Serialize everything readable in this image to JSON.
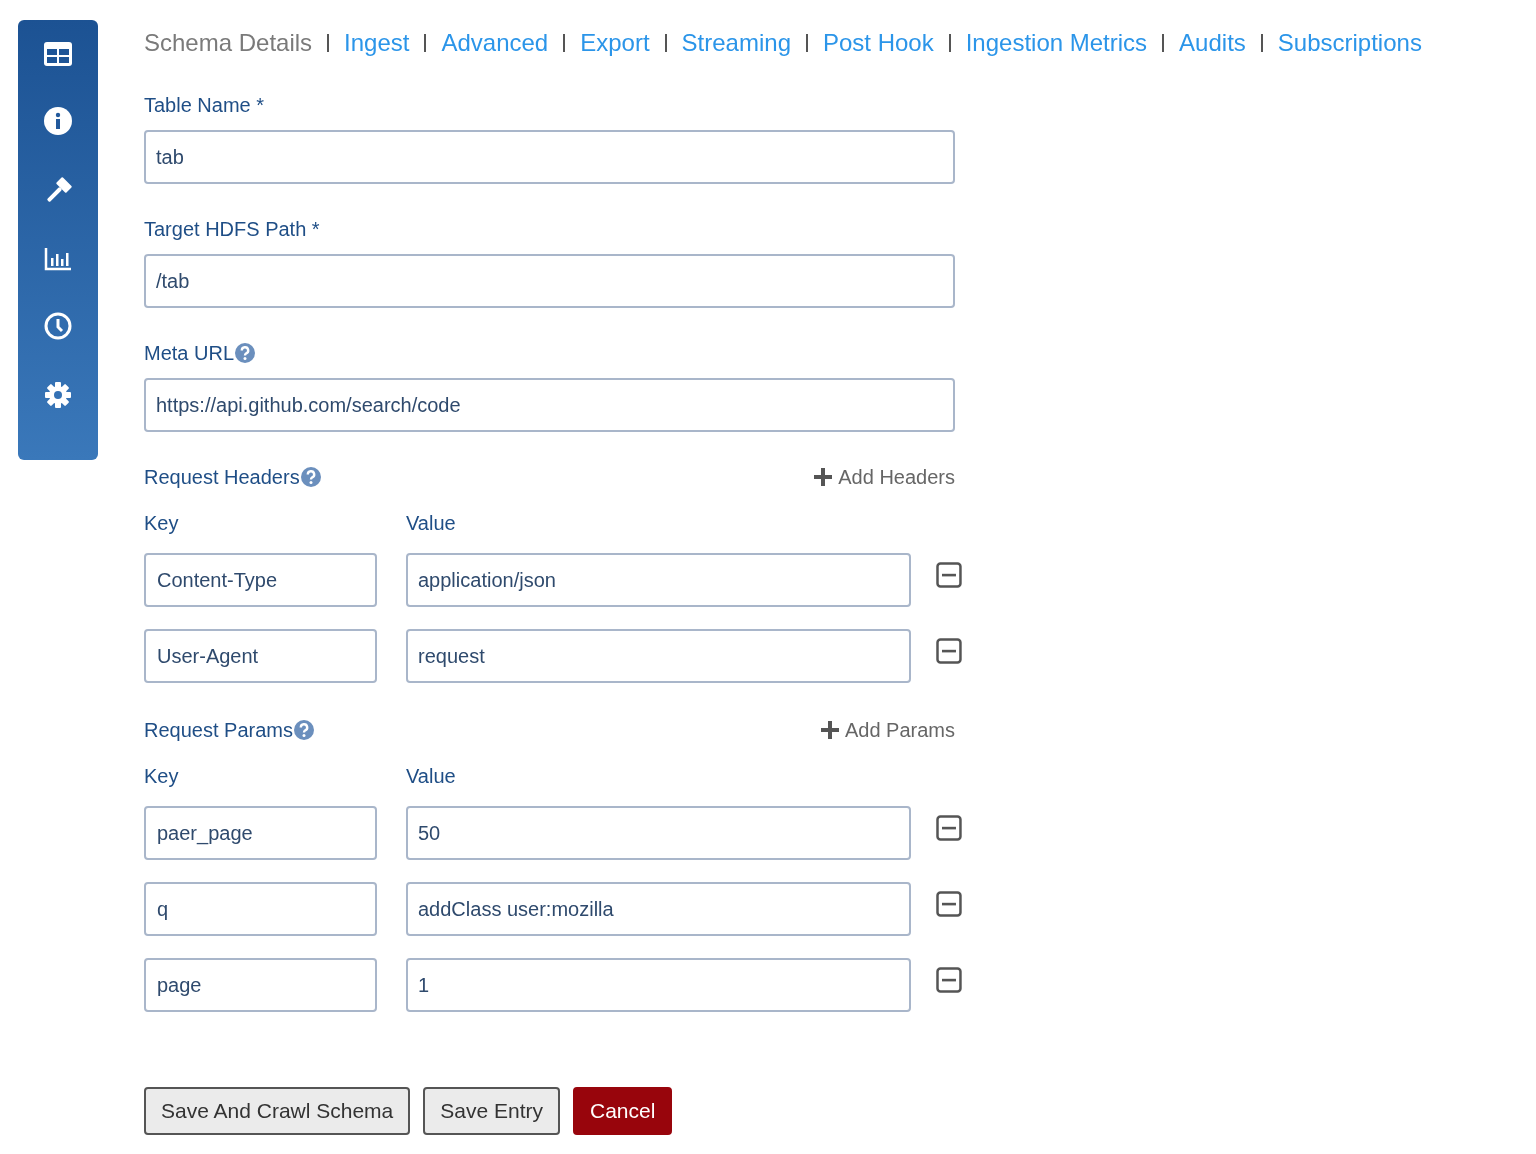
{
  "tabs": [
    {
      "label": "Schema Details",
      "selected": true
    },
    {
      "label": "Ingest",
      "selected": false
    },
    {
      "label": "Advanced",
      "selected": false
    },
    {
      "label": "Export",
      "selected": false
    },
    {
      "label": "Streaming",
      "selected": false
    },
    {
      "label": "Post Hook",
      "selected": false
    },
    {
      "label": "Ingestion Metrics",
      "selected": false
    },
    {
      "label": "Audits",
      "selected": false
    },
    {
      "label": "Subscriptions",
      "selected": false
    }
  ],
  "fields": [
    {
      "label": "Table Name *",
      "help": false,
      "value": "tab"
    },
    {
      "label": "Target HDFS Path *",
      "help": false,
      "value": "/tab"
    },
    {
      "label": "Meta URL",
      "help": true,
      "value": "https://api.github.com/search/code"
    }
  ],
  "sections": [
    {
      "title": "Request Headers",
      "add_label": "Add Headers",
      "key_heading": "Key",
      "value_heading": "Value",
      "rows": [
        {
          "key": "Content-Type",
          "value": "application/json"
        },
        {
          "key": "User-Agent",
          "value": "request"
        }
      ]
    },
    {
      "title": "Request Params",
      "add_label": "Add Params",
      "key_heading": "Key",
      "value_heading": "Value",
      "rows": [
        {
          "key": "paer_page",
          "value": "50"
        },
        {
          "key": "q",
          "value": "addClass user:mozilla"
        },
        {
          "key": "page",
          "value": "1"
        }
      ]
    }
  ],
  "buttons": [
    {
      "label": "Save And Crawl Schema",
      "kind": "default"
    },
    {
      "label": "Save Entry",
      "kind": "default"
    },
    {
      "label": "Cancel",
      "kind": "danger"
    }
  ]
}
